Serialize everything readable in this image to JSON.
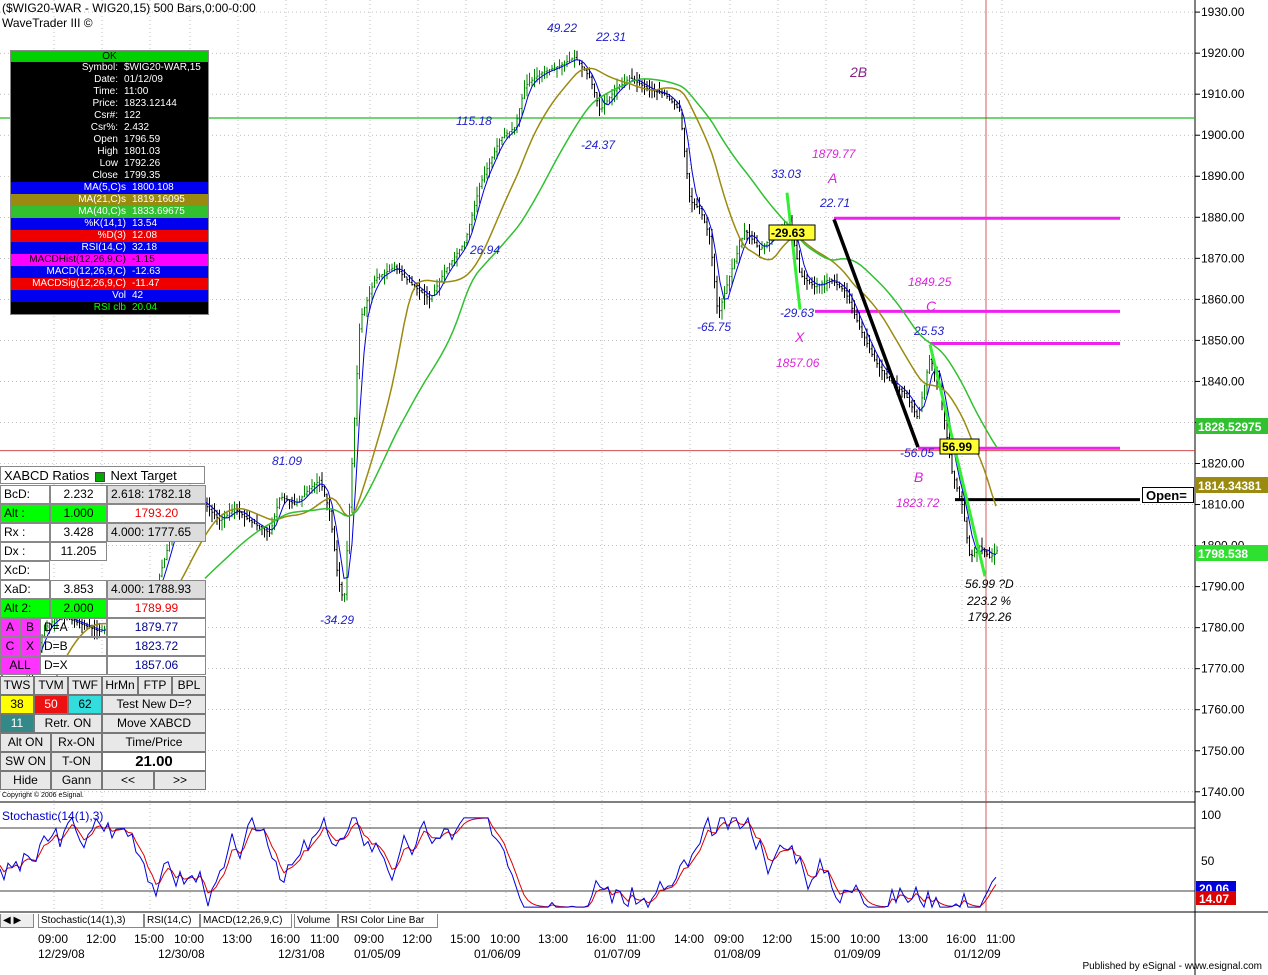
{
  "header": {
    "line1": "($WIG20-WAR - WIG20,15) 500 Bars,0:00-0:00",
    "line2": "WaveTrader III ©"
  },
  "info_panel": {
    "status": "OK",
    "rows": [
      {
        "k": "Symbol:",
        "v": "$WIG20-WAR,15"
      },
      {
        "k": "Date:",
        "v": "01/12/09"
      },
      {
        "k": "Time:",
        "v": "11:00"
      },
      {
        "k": "Price:",
        "v": "1823.12144"
      },
      {
        "k": "Csr#:",
        "v": "122"
      },
      {
        "k": "Csr%:",
        "v": "2.432"
      },
      {
        "k": "Open",
        "v": "1796.59"
      },
      {
        "k": "High",
        "v": "1801.03"
      },
      {
        "k": "Low",
        "v": "1792.26"
      },
      {
        "k": "Close",
        "v": "1799.35"
      }
    ],
    "indicators": [
      {
        "k": "MA(5,C)s",
        "v": "1800.108",
        "bg": "#0000ee",
        "fg": "#ffffff"
      },
      {
        "k": "MA(21,C)s",
        "v": "1819.16095",
        "bg": "#9a8a10",
        "fg": "#ffffff"
      },
      {
        "k": "MA(40,C)s",
        "v": "1833.69675",
        "bg": "#30c030",
        "fg": "#ffffff"
      },
      {
        "k": "%K(14,1)",
        "v": "13.54",
        "bg": "#0000ee",
        "fg": "#ffffff"
      },
      {
        "k": "%D(3)",
        "v": "12.08",
        "bg": "#ee0000",
        "fg": "#ffffff"
      },
      {
        "k": "RSI(14,C)",
        "v": "32.18",
        "bg": "#0000ee",
        "fg": "#ffffff"
      },
      {
        "k": "MACDHist(12,26,9,C)",
        "v": "-1.15",
        "bg": "#ff00ff",
        "fg": "#000000"
      },
      {
        "k": "MACD(12,26,9,C)",
        "v": "-12.63",
        "bg": "#0000ee",
        "fg": "#ffffff"
      },
      {
        "k": "MACDSig(12,26,9,C)",
        "v": "-11.47",
        "bg": "#ee0000",
        "fg": "#ffffff"
      },
      {
        "k": "Vol",
        "v": "42",
        "bg": "#0000ee",
        "fg": "#ffffff"
      },
      {
        "k": "RSI clb",
        "v": "20.04",
        "bg": "#000000",
        "fg": "#00ff00"
      }
    ]
  },
  "xabcd_panel": {
    "title": "XABCD Ratios",
    "next_target": "Next Target",
    "bcd_label": "BcD:",
    "bcd_val": "2.232",
    "bcd_target": "2.618: 1782.18",
    "alt_label": "Alt :",
    "alt_val": "1.000",
    "alt_target": "1793.20",
    "rx_label": "Rx :",
    "rx_val": "3.428",
    "rx_target": "4.000: 1777.65",
    "dx_label": "Dx :",
    "dx_val": "11.205",
    "xcd_label": "XcD:",
    "xad_label": "XaD:",
    "xad_val": "3.853",
    "xad_target": "4.000: 1788.93",
    "alt2_label": "Alt 2:",
    "alt2_val": "2.000",
    "alt2_target": "1789.99",
    "btn_a": "A",
    "btn_b": "B",
    "lbl_d_a": "D=A",
    "val_d_a": "1879.77",
    "btn_c": "C",
    "btn_x": "X",
    "lbl_d_b": "D=B",
    "val_d_b": "1823.72",
    "btn_all": "ALL",
    "lbl_d_x": "D=X",
    "val_d_x": "1857.06",
    "tools": [
      "TWS",
      "TVM",
      "TWF",
      "HrMn",
      "FTP",
      "BPL"
    ],
    "n38": "38",
    "n50": "50",
    "n62": "62",
    "test_new": "Test New D=?",
    "n11": "11",
    "retr_on": "Retr. ON",
    "move_xabcd": "Move XABCD",
    "alt_on": "Alt ON",
    "rx_on": "Rx-ON",
    "time_price": "Time/Price",
    "sw_on": "SW ON",
    "t_on": "T-ON",
    "time_price_val": "21.00",
    "hide": "Hide",
    "gann": "Gann",
    "prev": "<<",
    "next": ">>"
  },
  "copyright": "Copyright © 2006 eSignal.",
  "open_label": "Open=",
  "stochastic_label": "Stochastic(14(1),3)",
  "tabs": [
    "Stochastic(14(1),3)",
    "RSI(14,C)",
    "MACD(12,26,9,C)",
    "Volume",
    "RSI Color Line Bar"
  ],
  "published": "Published by eSignal - www.esignal.com",
  "chart_data": {
    "type": "candlestick",
    "y_ticks": [
      "1930.00",
      "1920.00",
      "1910.00",
      "1900.00",
      "1890.00",
      "1880.00",
      "1870.00",
      "1860.00",
      "1850.00",
      "1840.00",
      "1830.00",
      "1820.00",
      "1810.00",
      "1800.00",
      "1790.00",
      "1780.00",
      "1770.00",
      "1760.00",
      "1750.00",
      "1740.00"
    ],
    "ylim": [
      1738,
      1931
    ],
    "x_time_labels": [
      "09:00",
      "12:00",
      "15:00",
      "10:00",
      "13:00",
      "16:00",
      "11:00",
      "09:00",
      "12:00",
      "15:00",
      "10:00",
      "13:00",
      "16:00",
      "11:00",
      "14:00",
      "09:00",
      "12:00",
      "15:00",
      "10:00",
      "13:00",
      "16:00",
      "11:00"
    ],
    "x_date_labels": [
      "12/29/08",
      "12/30/08",
      "12/31/08",
      "01/05/09",
      "01/06/09",
      "01/07/09",
      "01/08/09",
      "01/09/09",
      "01/12/09"
    ],
    "price_path": [
      [
        0,
        1752
      ],
      [
        15,
        1760
      ],
      [
        30,
        1770
      ],
      [
        45,
        1780
      ],
      [
        60,
        1783
      ],
      [
        80,
        1781
      ],
      [
        100,
        1779
      ],
      [
        120,
        1782
      ],
      [
        140,
        1784
      ],
      [
        155,
        1789
      ],
      [
        165,
        1797
      ],
      [
        175,
        1806
      ],
      [
        190,
        1812
      ],
      [
        205,
        1810
      ],
      [
        220,
        1806
      ],
      [
        235,
        1809
      ],
      [
        250,
        1806
      ],
      [
        270,
        1803
      ],
      [
        280,
        1812
      ],
      [
        295,
        1810
      ],
      [
        310,
        1814
      ],
      [
        320,
        1816
      ],
      [
        330,
        1808
      ],
      [
        338,
        1792
      ],
      [
        344,
        1786
      ],
      [
        352,
        1820
      ],
      [
        360,
        1855
      ],
      [
        375,
        1865
      ],
      [
        395,
        1868
      ],
      [
        410,
        1864
      ],
      [
        430,
        1860
      ],
      [
        445,
        1867
      ],
      [
        465,
        1874
      ],
      [
        480,
        1888
      ],
      [
        500,
        1899
      ],
      [
        515,
        1902
      ],
      [
        525,
        1912
      ],
      [
        540,
        1915
      ],
      [
        560,
        1917
      ],
      [
        575,
        1919
      ],
      [
        590,
        1914
      ],
      [
        600,
        1906
      ],
      [
        615,
        1911
      ],
      [
        630,
        1914
      ],
      [
        650,
        1911
      ],
      [
        665,
        1910
      ],
      [
        680,
        1906
      ],
      [
        690,
        1884
      ],
      [
        700,
        1882
      ],
      [
        710,
        1875
      ],
      [
        718,
        1856
      ],
      [
        730,
        1866
      ],
      [
        745,
        1877
      ],
      [
        760,
        1872
      ],
      [
        775,
        1876
      ],
      [
        790,
        1879
      ],
      [
        800,
        1866
      ],
      [
        815,
        1863
      ],
      [
        830,
        1865
      ],
      [
        845,
        1862
      ],
      [
        860,
        1853
      ],
      [
        875,
        1845
      ],
      [
        890,
        1840
      ],
      [
        905,
        1837
      ],
      [
        918,
        1831
      ],
      [
        930,
        1846
      ],
      [
        940,
        1838
      ],
      [
        952,
        1818
      ],
      [
        962,
        1810
      ],
      [
        970,
        1797
      ],
      [
        980,
        1800
      ],
      [
        990,
        1797
      ],
      [
        998,
        1799
      ]
    ],
    "ma_lines": [
      {
        "name": "MA(5,C)s",
        "color": "#0000dd",
        "last": 1800.108
      },
      {
        "name": "MA(21,C)s",
        "color": "#9a8a10",
        "last": 1819.16095
      },
      {
        "name": "MA(40,C)s",
        "color": "#30c030",
        "last": 1833.69675
      }
    ],
    "price_labels": [
      {
        "t": "49.22",
        "c": "#2020cc",
        "x": 547,
        "y": 32
      },
      {
        "t": "22.31",
        "c": "#2020cc",
        "x": 596,
        "y": 41
      },
      {
        "t": "115.18",
        "c": "#2020cc",
        "x": 456,
        "y": 125
      },
      {
        "t": "-24.37",
        "c": "#2020cc",
        "x": 581,
        "y": 149
      },
      {
        "t": "26.94",
        "c": "#2020cc",
        "x": 470,
        "y": 254
      },
      {
        "t": "81.09",
        "c": "#2020cc",
        "x": 272,
        "y": 465
      },
      {
        "t": "-34.29",
        "c": "#2020cc",
        "x": 320,
        "y": 624
      },
      {
        "t": "33.03",
        "c": "#2020cc",
        "x": 771,
        "y": 178
      },
      {
        "t": "22.71",
        "c": "#2020cc",
        "x": 820,
        "y": 207
      },
      {
        "t": "-65.75",
        "c": "#2020cc",
        "x": 697,
        "y": 331
      },
      {
        "t": "-29.63",
        "c": "#2020cc",
        "x": 780,
        "y": 317
      },
      {
        "t": "25.53",
        "c": "#2020cc",
        "x": 914,
        "y": 335
      },
      {
        "t": "-56.05",
        "c": "#2020cc",
        "x": 900,
        "y": 457
      },
      {
        "t": "1879.77",
        "c": "#dd22dd",
        "x": 812,
        "y": 158
      },
      {
        "t": "A",
        "c": "#dd22dd",
        "x": 828,
        "y": 183
      },
      {
        "t": "1849.25",
        "c": "#dd22dd",
        "x": 908,
        "y": 286
      },
      {
        "t": "C",
        "c": "#dd22dd",
        "x": 926,
        "y": 311
      },
      {
        "t": "X",
        "c": "#dd22dd",
        "x": 795,
        "y": 342
      },
      {
        "t": "1857.06",
        "c": "#dd22dd",
        "x": 776,
        "y": 367
      },
      {
        "t": "B",
        "c": "#dd22dd",
        "x": 914,
        "y": 482
      },
      {
        "t": "1823.72",
        "c": "#dd22dd",
        "x": 896,
        "y": 507
      },
      {
        "t": "2B",
        "c": "#882288",
        "x": 850,
        "y": 77
      },
      {
        "t": "56.99 ?D",
        "c": "#000000",
        "x": 965,
        "y": 588
      },
      {
        "t": "223.2 %",
        "c": "#000000",
        "x": 967,
        "y": 605
      },
      {
        "t": "1792.26",
        "c": "#000000",
        "x": 968,
        "y": 621
      }
    ],
    "boxed_labels": [
      {
        "t": "-29.63",
        "x": 771,
        "y": 237
      },
      {
        "t": "56.99",
        "x": 942,
        "y": 451
      }
    ],
    "axis_badges": [
      {
        "t": "1828.52975",
        "bg": "#30c030",
        "y": 426
      },
      {
        "t": "1814.34381",
        "bg": "#9a8a10",
        "y": 485
      },
      {
        "t": "1798.538",
        "bg": "#30e030",
        "y": 553
      }
    ],
    "stoch_axis": [
      {
        "t": "100",
        "y": 815
      },
      {
        "t": "50",
        "y": 861
      }
    ],
    "stoch_badges": [
      {
        "t": "20.06",
        "bg": "#0000dd",
        "y": 888
      },
      {
        "t": "14.07",
        "bg": "#dd0000",
        "y": 898
      }
    ]
  }
}
